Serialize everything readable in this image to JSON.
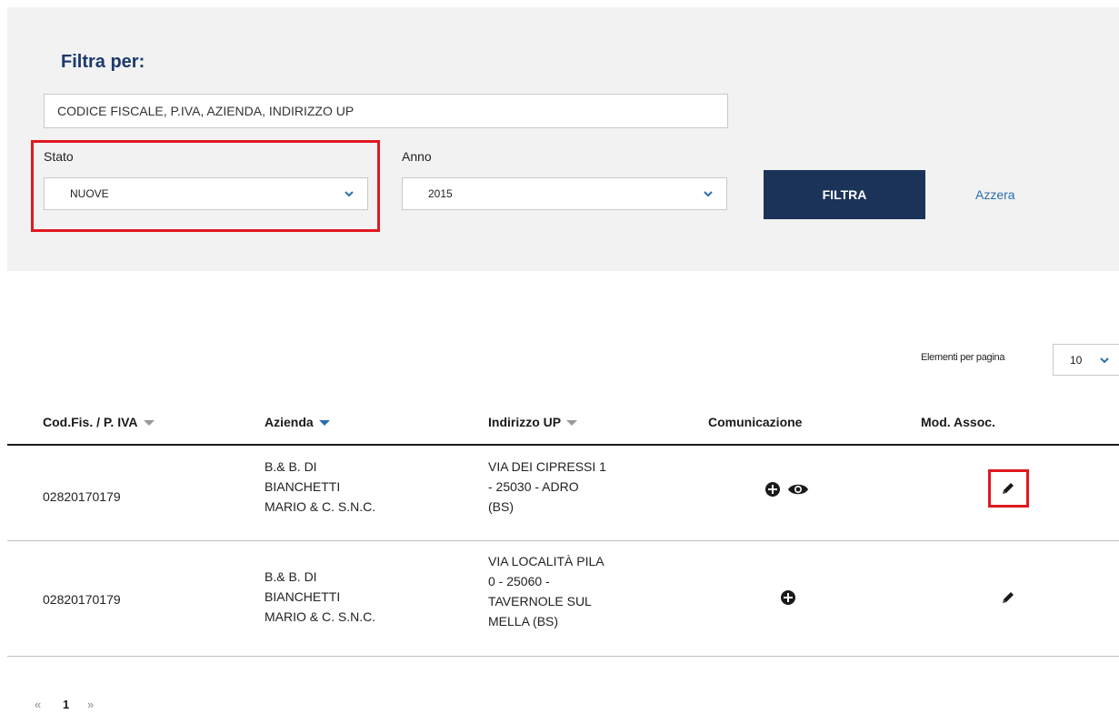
{
  "filter": {
    "title": "Filtra per:",
    "search_placeholder": "CODICE FISCALE, P.IVA, AZIENDA, INDIRIZZO UP",
    "stato_label": "Stato",
    "stato_value": "NUOVE",
    "anno_label": "Anno",
    "anno_value": "2015",
    "filter_button": "FILTRA",
    "reset_link": "Azzera"
  },
  "table": {
    "per_page_label": "Elementi per pagina",
    "per_page_value": "10",
    "columns": [
      "Cod.Fis. / P. IVA",
      "Azienda",
      "Indirizzo UP",
      "Comunicazione",
      "Mod. Assoc."
    ],
    "rows": [
      {
        "codice": "02820170179",
        "azienda": [
          "B.& B. DI",
          "BIANCHETTI",
          "MARIO & C. S.N.C."
        ],
        "indirizzo": [
          "VIA DEI CIPRESSI 1",
          "- 25030 - ADRO",
          "(BS)"
        ]
      },
      {
        "codice": "02820170179",
        "azienda": [
          "B.& B. DI",
          "BIANCHETTI",
          "MARIO & C. S.N.C."
        ],
        "indirizzo": [
          "VIA LOCALITÀ PILA",
          "0 - 25060 -",
          "TAVERNOLE SUL",
          "MELLA (BS)"
        ]
      }
    ]
  },
  "pagination": {
    "prev": "«",
    "current": "1",
    "next": "»"
  },
  "colors": {
    "primary_button": "#1b3358",
    "link": "#2a6fb0",
    "highlight": "#e0181f",
    "panel_bg": "#f2f2f2"
  },
  "icons": [
    "chevron-down-icon",
    "plus-circle-icon",
    "eye-icon",
    "pencil-icon"
  ]
}
